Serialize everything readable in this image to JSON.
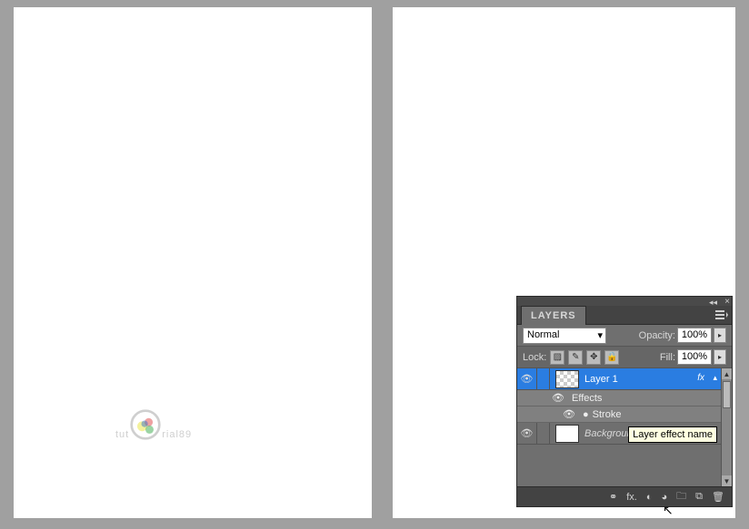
{
  "watermark": {
    "text_left": "tut",
    "text_right": "rial89"
  },
  "panel": {
    "title": "LAYERS",
    "blend_mode": "Normal",
    "opacity_label": "Opacity:",
    "opacity_value": "100%",
    "lock_label": "Lock:",
    "fill_label": "Fill:",
    "fill_value": "100%",
    "layers": [
      {
        "name": "Layer 1",
        "selected": true,
        "has_fx": true,
        "fx_label": "fx"
      },
      {
        "name": "Background",
        "selected": false,
        "italic": true
      }
    ],
    "effects_label": "Effects",
    "effect_items": [
      "Stroke"
    ],
    "tooltip": "Layer effect name",
    "footer_icons": {
      "link": "⚭",
      "fx": "fx.",
      "mask": "◐",
      "adjust": "◕",
      "group": "🗀",
      "new": "⧉",
      "trash": "🗑"
    }
  }
}
